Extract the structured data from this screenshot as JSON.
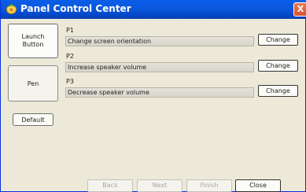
{
  "window": {
    "title": "Panel Control Center",
    "close_glyph": "X"
  },
  "sidebar": {
    "launch_button": "Launch\nButton",
    "pen": "Pen",
    "default": "Default"
  },
  "actions": [
    {
      "label": "P1",
      "value": "Change screen orientation",
      "button": "Change"
    },
    {
      "label": "P2",
      "value": "Increase speaker volume",
      "button": "Change"
    },
    {
      "label": "P3",
      "value": "Decrease speaker volume",
      "button": "Change"
    }
  ],
  "wizard": {
    "back": "Back",
    "next": "Next",
    "finish": "Finish",
    "close": "Close"
  },
  "icons": {
    "app": "tablet-panel-icon",
    "close": "close-icon"
  }
}
